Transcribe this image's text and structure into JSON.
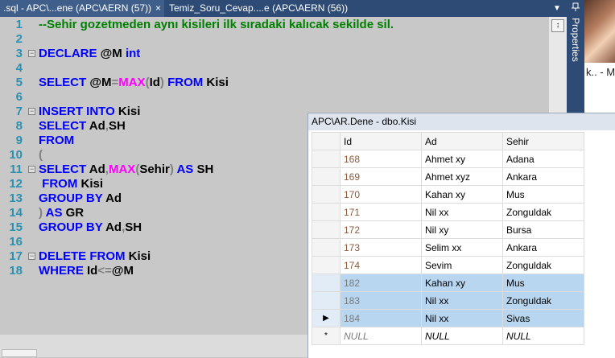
{
  "tabs": [
    {
      "label": ".sql - APC\\...ene (APC\\AERN (57))",
      "close": "×",
      "active": true
    },
    {
      "label": "Temiz_Soru_Cevap....e (APC\\AERN (56))",
      "active": false
    }
  ],
  "tab_dropdown": "▼",
  "properties_label": "Properties",
  "photo_caption": "k.. - M",
  "editor": {
    "lines": [
      {
        "n": "1",
        "fold": "",
        "segments": [
          {
            "c": "cm",
            "t": "--Sehir gozetmeden aynı kisileri ilk sıradaki kalıcak sekilde sil."
          }
        ]
      },
      {
        "n": "2",
        "fold": "",
        "segments": []
      },
      {
        "n": "3",
        "fold": "−",
        "segments": [
          {
            "c": "kw",
            "t": "DECLARE "
          },
          {
            "c": "tx",
            "t": "@M "
          },
          {
            "c": "kw",
            "t": "int"
          }
        ]
      },
      {
        "n": "4",
        "fold": "",
        "segments": []
      },
      {
        "n": "5",
        "fold": "",
        "segments": [
          {
            "c": "kw",
            "t": "SELECT "
          },
          {
            "c": "tx",
            "t": "@M"
          },
          {
            "c": "op",
            "t": "="
          },
          {
            "c": "fn",
            "t": "MAX"
          },
          {
            "c": "op",
            "t": "("
          },
          {
            "c": "tx",
            "t": "Id"
          },
          {
            "c": "op",
            "t": ") "
          },
          {
            "c": "kw",
            "t": "FROM "
          },
          {
            "c": "tx",
            "t": "Kisi"
          }
        ]
      },
      {
        "n": "6",
        "fold": "",
        "segments": []
      },
      {
        "n": "7",
        "fold": "−",
        "segments": [
          {
            "c": "kw",
            "t": "INSERT INTO "
          },
          {
            "c": "tx",
            "t": "Kisi"
          }
        ]
      },
      {
        "n": "8",
        "fold": "",
        "segments": [
          {
            "c": "kw",
            "t": "SELECT "
          },
          {
            "c": "tx",
            "t": "Ad"
          },
          {
            "c": "op",
            "t": ","
          },
          {
            "c": "tx",
            "t": "SH"
          }
        ]
      },
      {
        "n": "9",
        "fold": "",
        "segments": [
          {
            "c": "kw",
            "t": "FROM"
          }
        ]
      },
      {
        "n": "10",
        "fold": "",
        "segments": [
          {
            "c": "op",
            "t": "("
          }
        ]
      },
      {
        "n": "11",
        "fold": "−",
        "segments": [
          {
            "c": "kw",
            "t": "SELECT "
          },
          {
            "c": "tx",
            "t": "Ad"
          },
          {
            "c": "op",
            "t": ","
          },
          {
            "c": "fn",
            "t": "MAX"
          },
          {
            "c": "op",
            "t": "("
          },
          {
            "c": "tx",
            "t": "Sehir"
          },
          {
            "c": "op",
            "t": ") "
          },
          {
            "c": "kw",
            "t": "AS "
          },
          {
            "c": "tx",
            "t": "SH"
          }
        ]
      },
      {
        "n": "12",
        "fold": "",
        "segments": [
          {
            "c": "kw",
            "t": " FROM "
          },
          {
            "c": "tx",
            "t": "Kisi"
          }
        ]
      },
      {
        "n": "13",
        "fold": "",
        "segments": [
          {
            "c": "kw",
            "t": "GROUP BY "
          },
          {
            "c": "tx",
            "t": "Ad"
          }
        ]
      },
      {
        "n": "14",
        "fold": "",
        "segments": [
          {
            "c": "op",
            "t": ") "
          },
          {
            "c": "kw",
            "t": "AS "
          },
          {
            "c": "tx",
            "t": "GR"
          }
        ]
      },
      {
        "n": "15",
        "fold": "",
        "segments": [
          {
            "c": "kw",
            "t": "GROUP BY "
          },
          {
            "c": "tx",
            "t": "Ad"
          },
          {
            "c": "op",
            "t": ","
          },
          {
            "c": "tx",
            "t": "SH"
          }
        ]
      },
      {
        "n": "16",
        "fold": "",
        "segments": []
      },
      {
        "n": "17",
        "fold": "−",
        "segments": [
          {
            "c": "kw",
            "t": "DELETE FROM "
          },
          {
            "c": "tx",
            "t": "Kisi"
          }
        ]
      },
      {
        "n": "18",
        "fold": "",
        "segments": [
          {
            "c": "kw",
            "t": "WHERE "
          },
          {
            "c": "tx",
            "t": "Id"
          },
          {
            "c": "op",
            "t": "<="
          },
          {
            "c": "tx",
            "t": "@M"
          }
        ]
      }
    ]
  },
  "splitter_glyph": "↕",
  "grid": {
    "title": "APC\\AR.Dene - dbo.Kisi",
    "columns": [
      "Id",
      "Ad",
      "Sehir"
    ],
    "rows": [
      {
        "marker": "",
        "id": "168",
        "ad": "Ahmet xy",
        "sehir": "Adana",
        "selected": false
      },
      {
        "marker": "",
        "id": "169",
        "ad": "Ahmet xyz",
        "sehir": "Ankara",
        "selected": false
      },
      {
        "marker": "",
        "id": "170",
        "ad": "Kahan xy",
        "sehir": "Mus",
        "selected": false
      },
      {
        "marker": "",
        "id": "171",
        "ad": "Nil xx",
        "sehir": "Zonguldak",
        "selected": false
      },
      {
        "marker": "",
        "id": "172",
        "ad": "Nil xy",
        "sehir": "Bursa",
        "selected": false
      },
      {
        "marker": "",
        "id": "173",
        "ad": "Selim xx",
        "sehir": "Ankara",
        "selected": false
      },
      {
        "marker": "",
        "id": "174",
        "ad": "Sevim",
        "sehir": "Zonguldak",
        "selected": false
      },
      {
        "marker": "",
        "id": "182",
        "ad": "Kahan xy",
        "sehir": "Mus",
        "selected": true
      },
      {
        "marker": "",
        "id": "183",
        "ad": "Nil xx",
        "sehir": "Zonguldak",
        "selected": true
      },
      {
        "marker": "▶",
        "id": "184",
        "ad": "Nil xx",
        "sehir": "Sivas",
        "selected": true
      },
      {
        "marker": "*",
        "id": "NULL",
        "ad": "NULL",
        "sehir": "NULL",
        "selected": false,
        "new_row": true
      }
    ]
  },
  "colors": {
    "keyword": "#0000ff",
    "function": "#ff00ff",
    "comment": "#008000",
    "line_number": "#2b91af",
    "tab_bar": "#2d4b74",
    "selection": "#b8d6f0"
  }
}
